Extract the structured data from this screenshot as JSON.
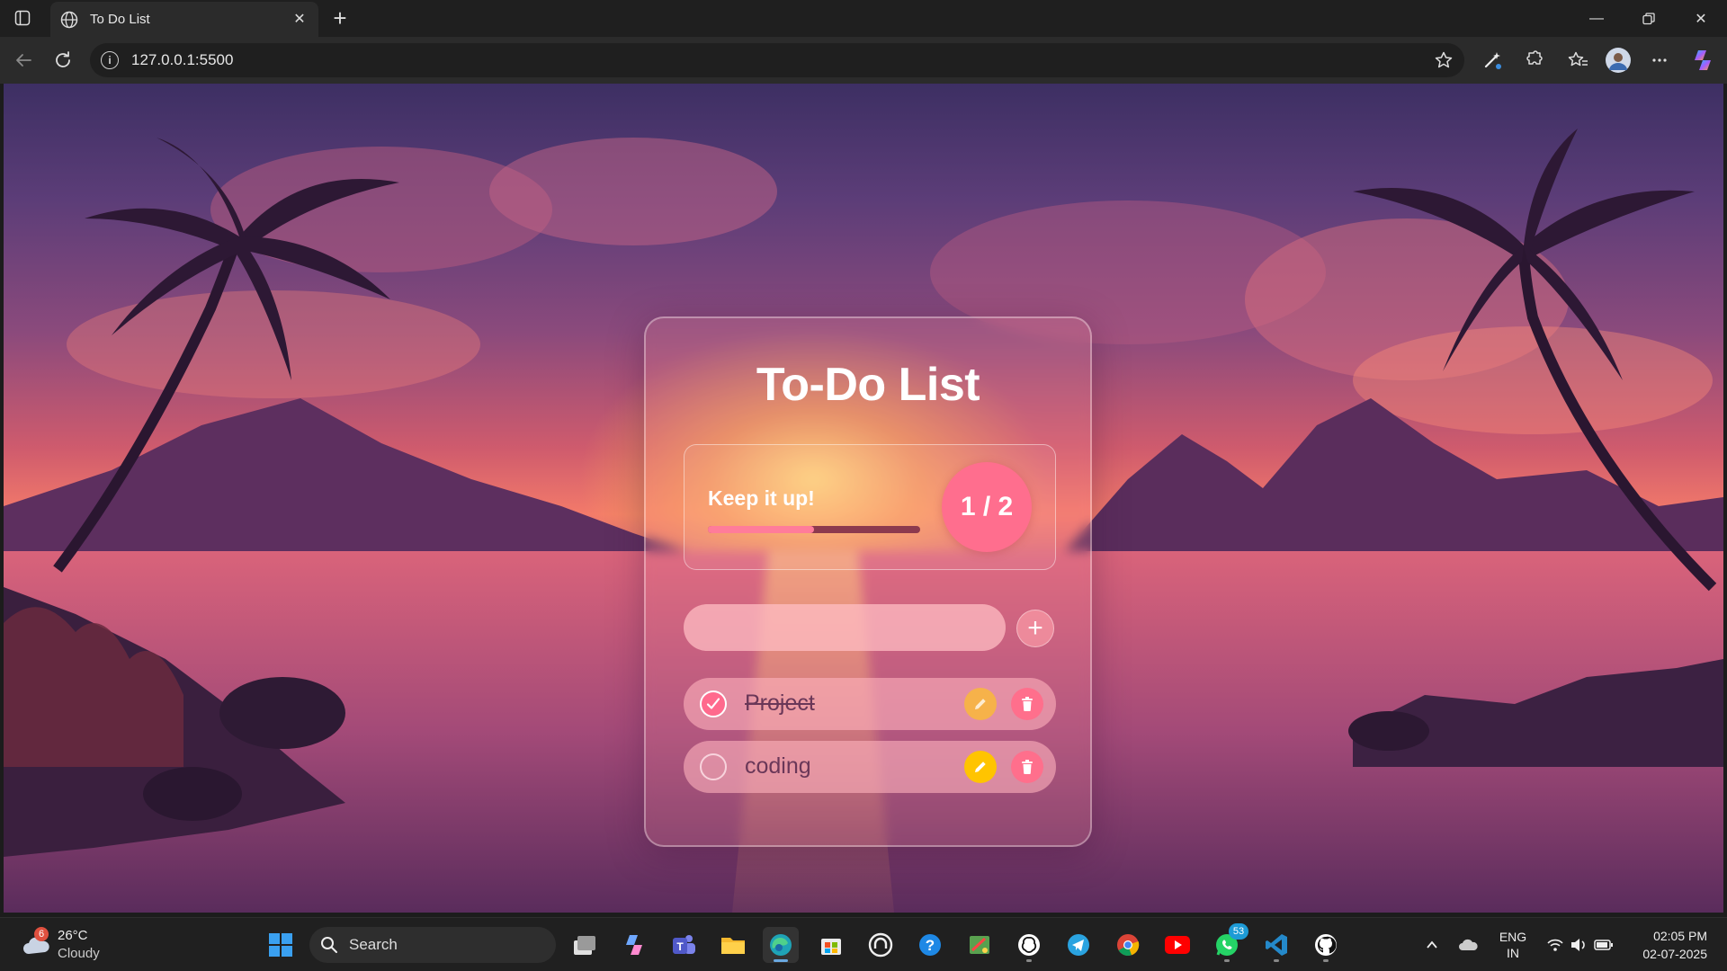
{
  "browser": {
    "tab_title": "To Do List",
    "url": "127.0.0.1:5500"
  },
  "app": {
    "title": "To-Do List",
    "stats": {
      "message": "Keep it up!",
      "completed": 1,
      "total": 2,
      "count_text": "1 / 2",
      "progress": 0.5
    },
    "input": {
      "value": "",
      "placeholder": ""
    },
    "add_label": "+",
    "tasks": [
      {
        "text": "Project",
        "done": true
      },
      {
        "text": "coding",
        "done": false
      }
    ]
  },
  "colors": {
    "accent_pink": "#ff6e8e",
    "edit_yellow": "#ffc400",
    "edit_yellow_faded": "#f6b24a",
    "delete_pink": "#ff6f8c"
  },
  "taskbar": {
    "weather_temp": "26°C",
    "weather_cond": "Cloudy",
    "weather_badge": "6",
    "search_label": "Search",
    "whatsapp_badge": "53",
    "lang_line1": "ENG",
    "lang_line2": "IN",
    "time": "02:05 PM",
    "date": "02-07-2025",
    "icons": [
      "start-icon",
      "search-icon",
      "task-view-icon",
      "copilot-icon",
      "teams-icon",
      "file-explorer-icon",
      "edge-icon",
      "store-icon",
      "copilot-app-icon",
      "help-icon",
      "paint-icon",
      "chatgpt-icon",
      "telegram-icon",
      "chrome-icon",
      "youtube-icon",
      "whatsapp-icon",
      "vscode-icon",
      "github-icon"
    ]
  }
}
